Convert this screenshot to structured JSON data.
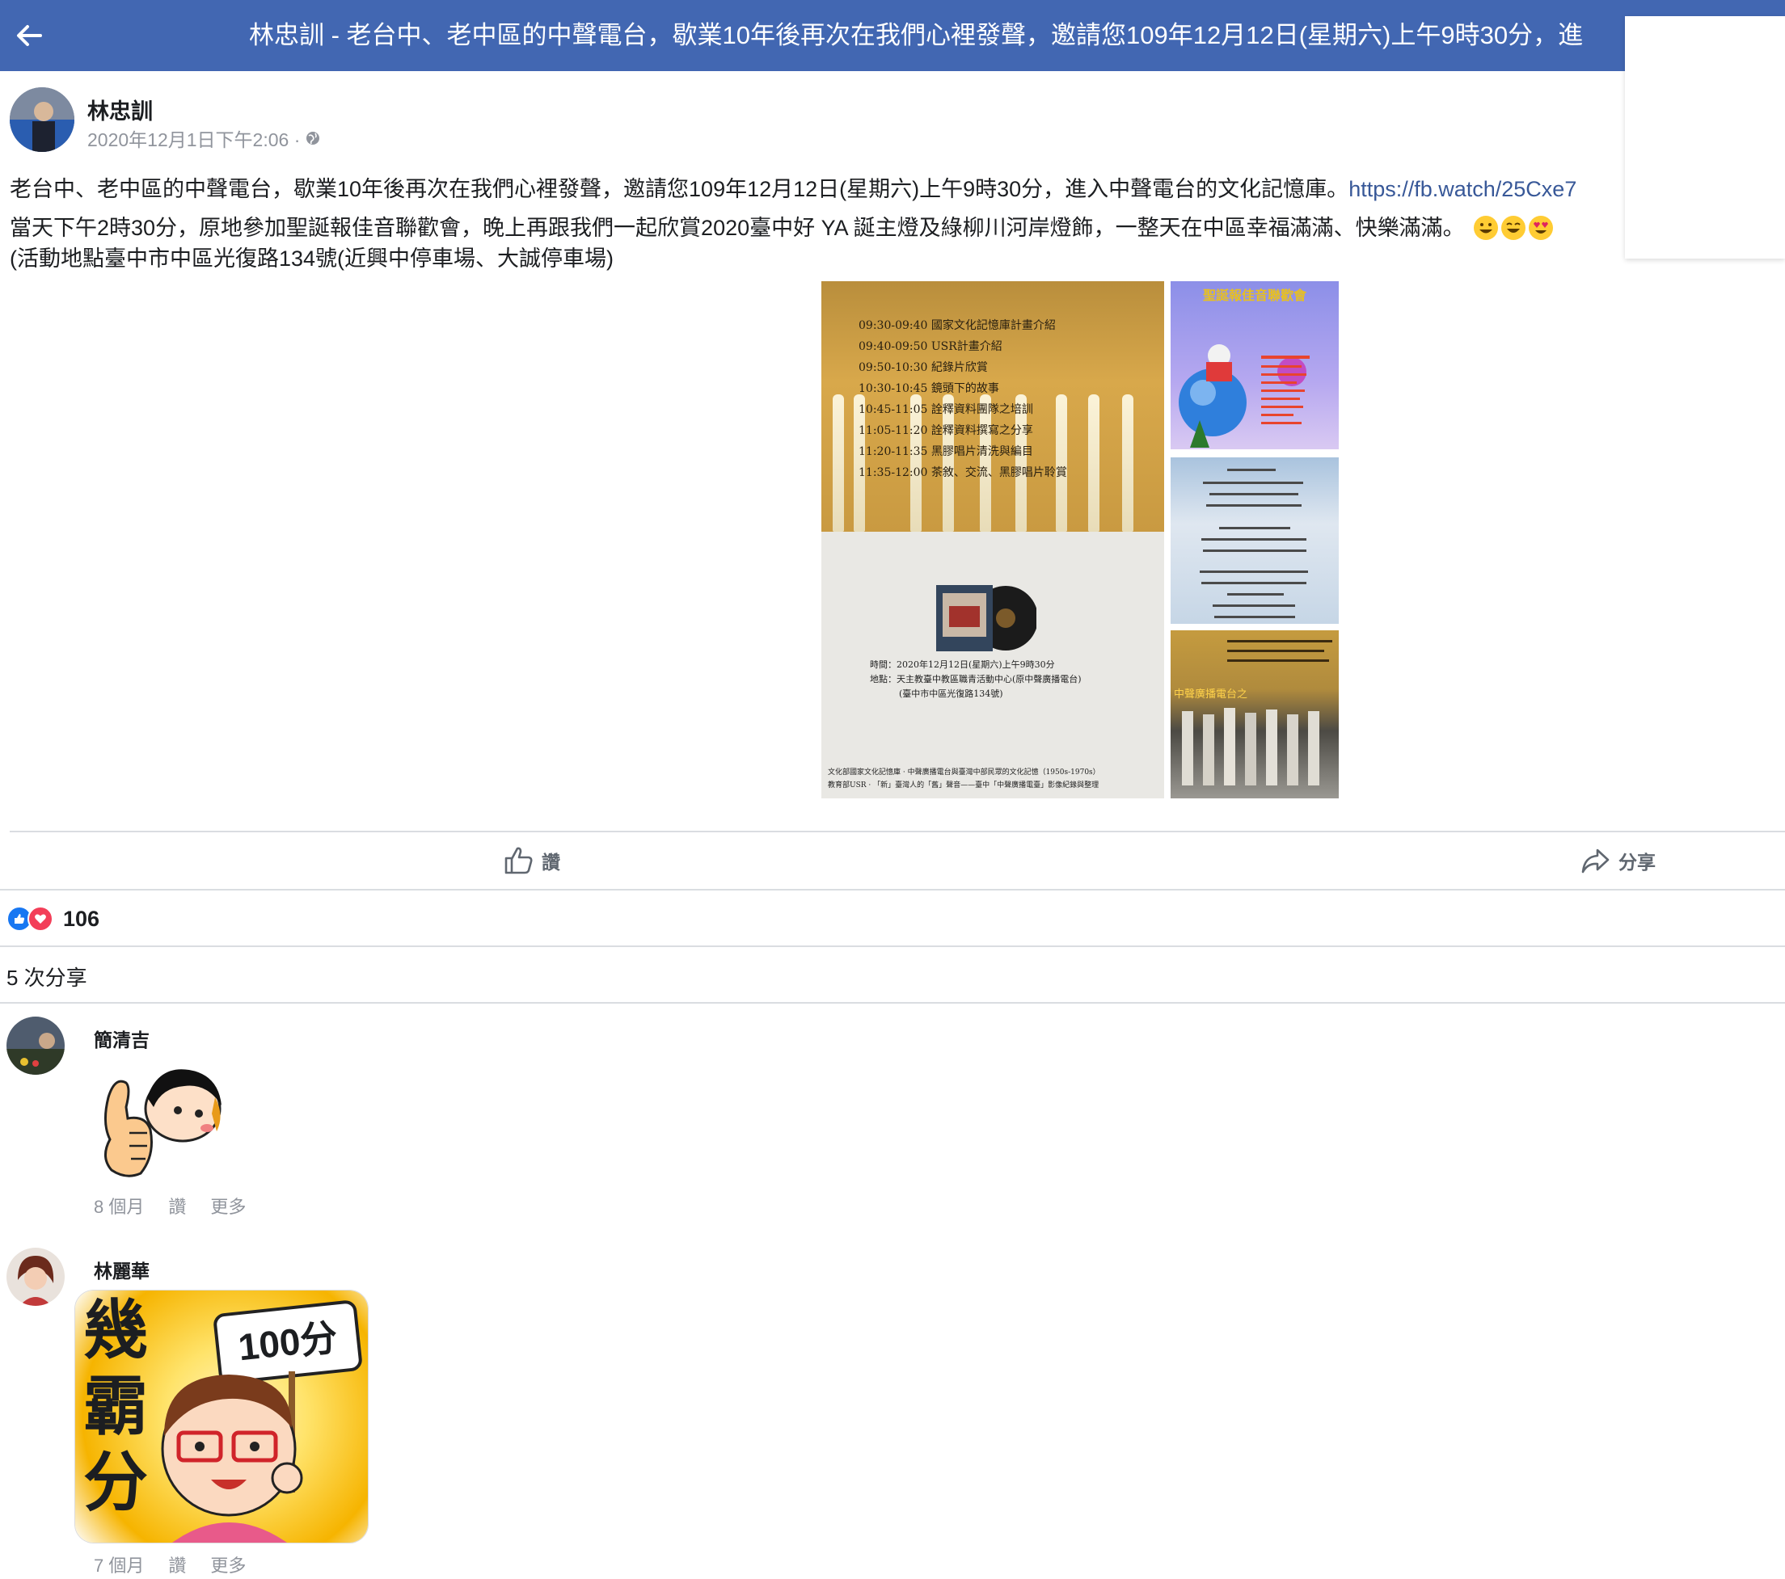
{
  "header": {
    "title": "林忠訓 - 老台中、老中區的中聲電台，歇業10年後再次在我們心裡發聲，邀請您109年12月12日(星期六)上午9時30分，進"
  },
  "post": {
    "author": "林忠訓",
    "timestamp": "2020年12月1日下午2:06 ·",
    "line1": "老台中、老中區的中聲電台，歇業10年後再次在我們心裡發聲，邀請您109年12月12日(星期六)上午9時30分，進入中聲電台的文化記憶庫。",
    "link": "https://fb.watch/25Cxe7",
    "line2": "當天下午2時30分，原地參加聖誕報佳音聯歡會，晚上再跟我們一起欣賞2020臺中好 YA 誕主燈及綠柳川河岸燈飾，一整天在中區幸福滿滿、快樂滿滿。",
    "line3": "(活動地點臺中市中區光復路134號(近興中停車場、大誠停車場)",
    "poster": {
      "schedule": [
        "09:30-09:40  國家文化記憶庫計畫介紹",
        "09:40-09:50  USR計畫介紹",
        "09:50-10:30  紀錄片欣賞",
        "10:30-10:45  鏡頭下的故事",
        "10:45-11:05  詮釋資料團隊之培訓",
        "11:05-11:20  詮釋資料撰寫之分享",
        "11:20-11:35  黑膠唱片清洗與編目",
        "11:35-12:00  茶敘、交流、黑膠唱片聆賞"
      ],
      "time_line": "時間：2020年12月12日(星期六)上午9時30分",
      "place_line": "地點：天主教臺中教區職青活動中心(原中聲廣播電台)",
      "address_line": "(臺中市中區光復路134號)",
      "footer1": "文化部國家文化記憶庫 · 中聲廣播電台與臺灣中部民眾的文化記憶（1950s-1970s）",
      "footer2": "教育部USR · 「新」臺灣人的「舊」聲音——臺中「中聲廣播電臺」影像紀錄與整理"
    },
    "thumb1_title": "聖誕報佳音聯歡會",
    "thumb3_title": "中聲廣播電台之"
  },
  "actions": {
    "like_label": "讚",
    "share_label": "分享"
  },
  "reactions": {
    "count": "106"
  },
  "shares": {
    "text": "5 次分享"
  },
  "comments": [
    {
      "author": "簡清吉",
      "age": "8 個月",
      "like": "讚",
      "more": "更多"
    },
    {
      "author": "林麗華",
      "age": "7 個月",
      "like": "讚",
      "more": "更多",
      "sticker_text": "幾霸分",
      "sticker_sign": "100分"
    }
  ],
  "colors": {
    "header_bg": "#4267b2",
    "link": "#385898",
    "like_blue": "#1877f2",
    "love_red": "#f33e58"
  }
}
